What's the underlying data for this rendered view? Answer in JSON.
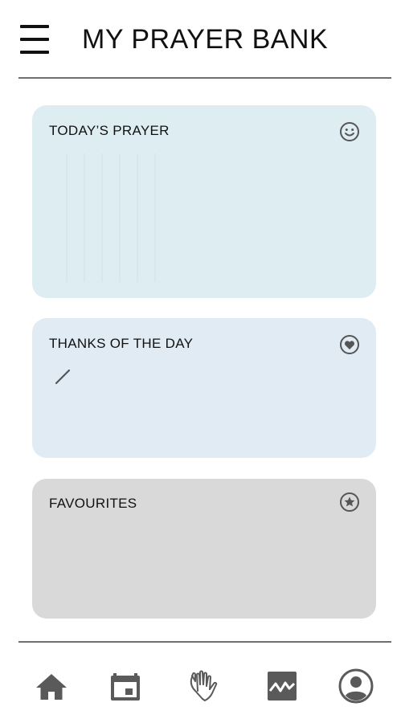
{
  "header": {
    "title": "MY PRAYER BANK",
    "menu_icon": "hamburger-menu-icon"
  },
  "cards": {
    "todays_prayer": {
      "title": "TODAY’S PRAYER",
      "icon": "smiley-icon",
      "color": "#deedf2"
    },
    "thanks_of_the_day": {
      "title": "THANKS OF THE DAY",
      "icon": "heart-circle-icon",
      "edit_icon": "pencil-icon",
      "color": "#e0ebf4"
    },
    "favourites": {
      "title": "FAVOURITES",
      "icon": "star-circle-icon",
      "color": "#d9d9d9"
    }
  },
  "bottom_nav": {
    "items": [
      {
        "icon": "home-icon"
      },
      {
        "icon": "calendar-icon"
      },
      {
        "icon": "praying-hands-icon"
      },
      {
        "icon": "chart-icon"
      },
      {
        "icon": "profile-icon"
      }
    ],
    "icon_color": "#5a5a5a"
  }
}
